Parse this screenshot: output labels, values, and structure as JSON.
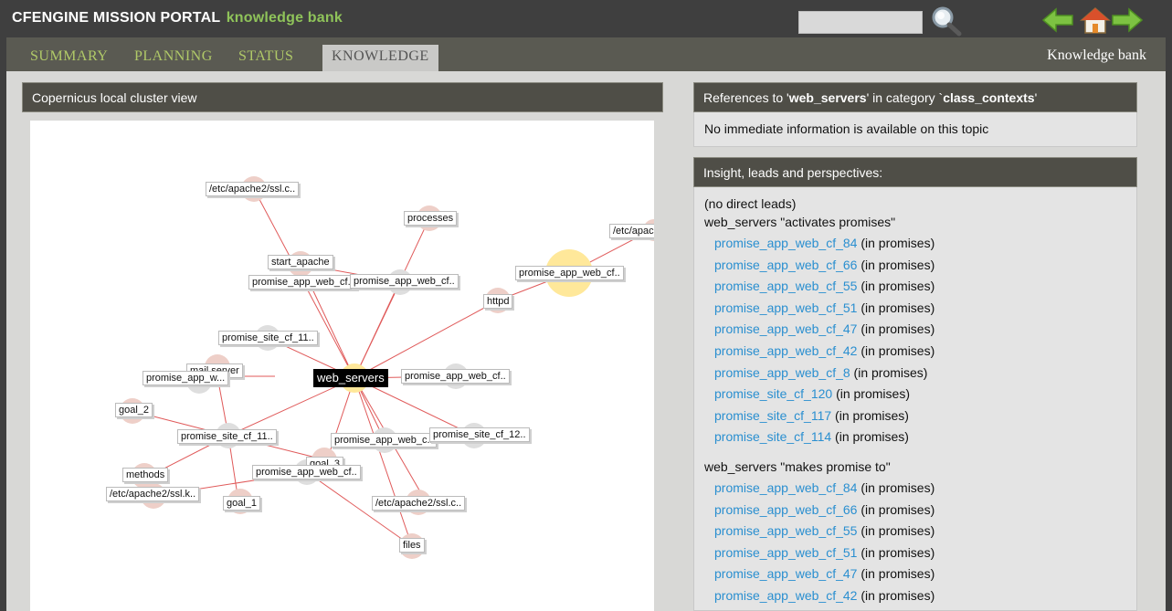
{
  "header": {
    "brand": "CFENGINE MISSION PORTAL",
    "brand_sub": "knowledge bank",
    "search_value": ""
  },
  "tabs": [
    {
      "label": "SUMMARY"
    },
    {
      "label": "PLANNING"
    },
    {
      "label": "STATUS"
    },
    {
      "label": "KNOWLEDGE"
    }
  ],
  "tab_right": "Knowledge bank",
  "left_panel": {
    "title": "Copernicus local cluster view"
  },
  "graph": {
    "center": "web_servers",
    "nodes": [
      {
        "id": "n1",
        "label": "/etc/apache2/ssl.c.."
      },
      {
        "id": "n2",
        "label": "processes"
      },
      {
        "id": "n3",
        "label": "/etc/apac"
      },
      {
        "id": "n4",
        "label": "start_apache"
      },
      {
        "id": "n5",
        "label": "promise_app_web_cf.."
      },
      {
        "id": "n6",
        "label": "promise_app_web_cf.."
      },
      {
        "id": "n7",
        "label": "promise_app_web_cf.."
      },
      {
        "id": "n8",
        "label": "httpd"
      },
      {
        "id": "n9",
        "label": "promise_site_cf_11.."
      },
      {
        "id": "n10",
        "label": "mail server"
      },
      {
        "id": "n11",
        "label": "promise_app_w..."
      },
      {
        "id": "n12",
        "label": "promise_app_web_cf.."
      },
      {
        "id": "n13",
        "label": "goal_2"
      },
      {
        "id": "n14",
        "label": "promise_site_cf_11.."
      },
      {
        "id": "n15",
        "label": "promise_app_web_c.."
      },
      {
        "id": "n16",
        "label": "promise_site_cf_12.."
      },
      {
        "id": "n17",
        "label": "goal_3"
      },
      {
        "id": "n18",
        "label": "methods"
      },
      {
        "id": "n19",
        "label": "promise_app_web_cf.."
      },
      {
        "id": "n20",
        "label": "/etc/apache2/ssl.k.."
      },
      {
        "id": "n21",
        "label": "goal_1"
      },
      {
        "id": "n22",
        "label": "/etc/apache2/ssl.c.."
      },
      {
        "id": "n23",
        "label": "files"
      }
    ]
  },
  "references": {
    "prefix": "References to '",
    "topic": "web_servers",
    "middle": "' in category `",
    "category": "class_contexts",
    "suffix": "'",
    "message": "No immediate information is available on this topic"
  },
  "insight": {
    "title": "Insight, leads and perspectives:",
    "no_leads": "(no direct leads)",
    "groups": [
      {
        "heading": "web_servers \"activates promises\"",
        "items": [
          {
            "link": "promise_app_web_cf_84",
            "note": " (in promises)"
          },
          {
            "link": "promise_app_web_cf_66",
            "note": " (in promises)"
          },
          {
            "link": "promise_app_web_cf_55",
            "note": " (in promises)"
          },
          {
            "link": "promise_app_web_cf_51",
            "note": " (in promises)"
          },
          {
            "link": "promise_app_web_cf_47",
            "note": " (in promises)"
          },
          {
            "link": "promise_app_web_cf_42",
            "note": " (in promises)"
          },
          {
            "link": "promise_app_web_cf_8",
            "note": " (in promises)"
          },
          {
            "link": "promise_site_cf_120",
            "note": " (in promises)"
          },
          {
            "link": "promise_site_cf_117",
            "note": " (in promises)"
          },
          {
            "link": "promise_site_cf_114",
            "note": " (in promises)"
          }
        ]
      },
      {
        "heading": "web_servers \"makes promise to\"",
        "items": [
          {
            "link": "promise_app_web_cf_84",
            "note": " (in promises)"
          },
          {
            "link": "promise_app_web_cf_66",
            "note": " (in promises)"
          },
          {
            "link": "promise_app_web_cf_55",
            "note": " (in promises)"
          },
          {
            "link": "promise_app_web_cf_51",
            "note": " (in promises)"
          },
          {
            "link": "promise_app_web_cf_47",
            "note": " (in promises)"
          },
          {
            "link": "promise_app_web_cf_42",
            "note": " (in promises)"
          }
        ]
      }
    ]
  },
  "colors": {
    "accent_green": "#8fc35a",
    "tab_text": "#b0c968",
    "link_blue": "#2a8fd0",
    "edge_red": "#e05a5a",
    "node_pink": "#eecfc8",
    "node_gray": "#dedede",
    "node_yellow": "#ffe89a"
  }
}
